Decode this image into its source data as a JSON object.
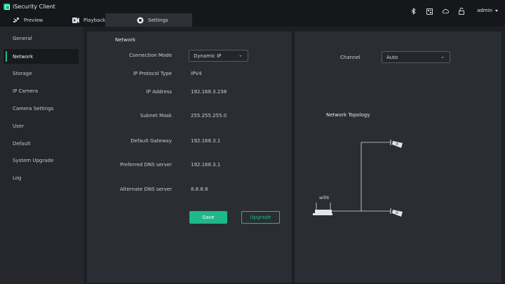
{
  "app": {
    "title": "iSecurity Client",
    "logo_color": "#1fb88a"
  },
  "tabs": [
    {
      "label": "Preview",
      "icon": "preview-icon"
    },
    {
      "label": "Playback",
      "icon": "playback-icon"
    },
    {
      "label": "Settings",
      "icon": "settings-icon"
    }
  ],
  "topbar": {
    "icons": [
      "bluetooth-icon",
      "qr-code-icon",
      "cloud-icon",
      "lock-icon"
    ],
    "user": "admin"
  },
  "sidebar": {
    "items": [
      {
        "label": "General"
      },
      {
        "label": "Network",
        "active": true
      },
      {
        "label": "Storage"
      },
      {
        "label": "IP Camera"
      },
      {
        "label": "Camera Settings"
      },
      {
        "label": "User"
      },
      {
        "label": "Default"
      },
      {
        "label": "System Upgrade"
      },
      {
        "label": "Log"
      }
    ]
  },
  "network": {
    "title": "Network",
    "connection_mode_label": "Connection Mode",
    "connection_mode_value": "Dynamic IP",
    "ip_protocol_label": "IP Protocol Type",
    "ip_protocol_value": "IPV4",
    "ip_address_label": "IP Address",
    "ip_address_value": "192.168.3.238",
    "subnet_mask_label": "Subnet Mask",
    "subnet_mask_value": "255.255.255.0",
    "gateway_label": "Default Gateway",
    "gateway_value": "192.168.3.1",
    "preferred_dns_label": "Preferred DNS server",
    "preferred_dns_value": "192.168.3.1",
    "alternate_dns_label": "Alternate DNS server",
    "alternate_dns_value": "8.8.8.8",
    "save_label": "Save",
    "upgrade_label": "Upgrade"
  },
  "channel": {
    "label": "Channel",
    "value": "Auto"
  },
  "topology": {
    "title": "Network Topology",
    "router_label": "wifi6"
  },
  "colors": {
    "accent": "#1fb88a",
    "panel": "#2a2d33",
    "sidebar": "#25272c",
    "topbar": "#15171b"
  }
}
